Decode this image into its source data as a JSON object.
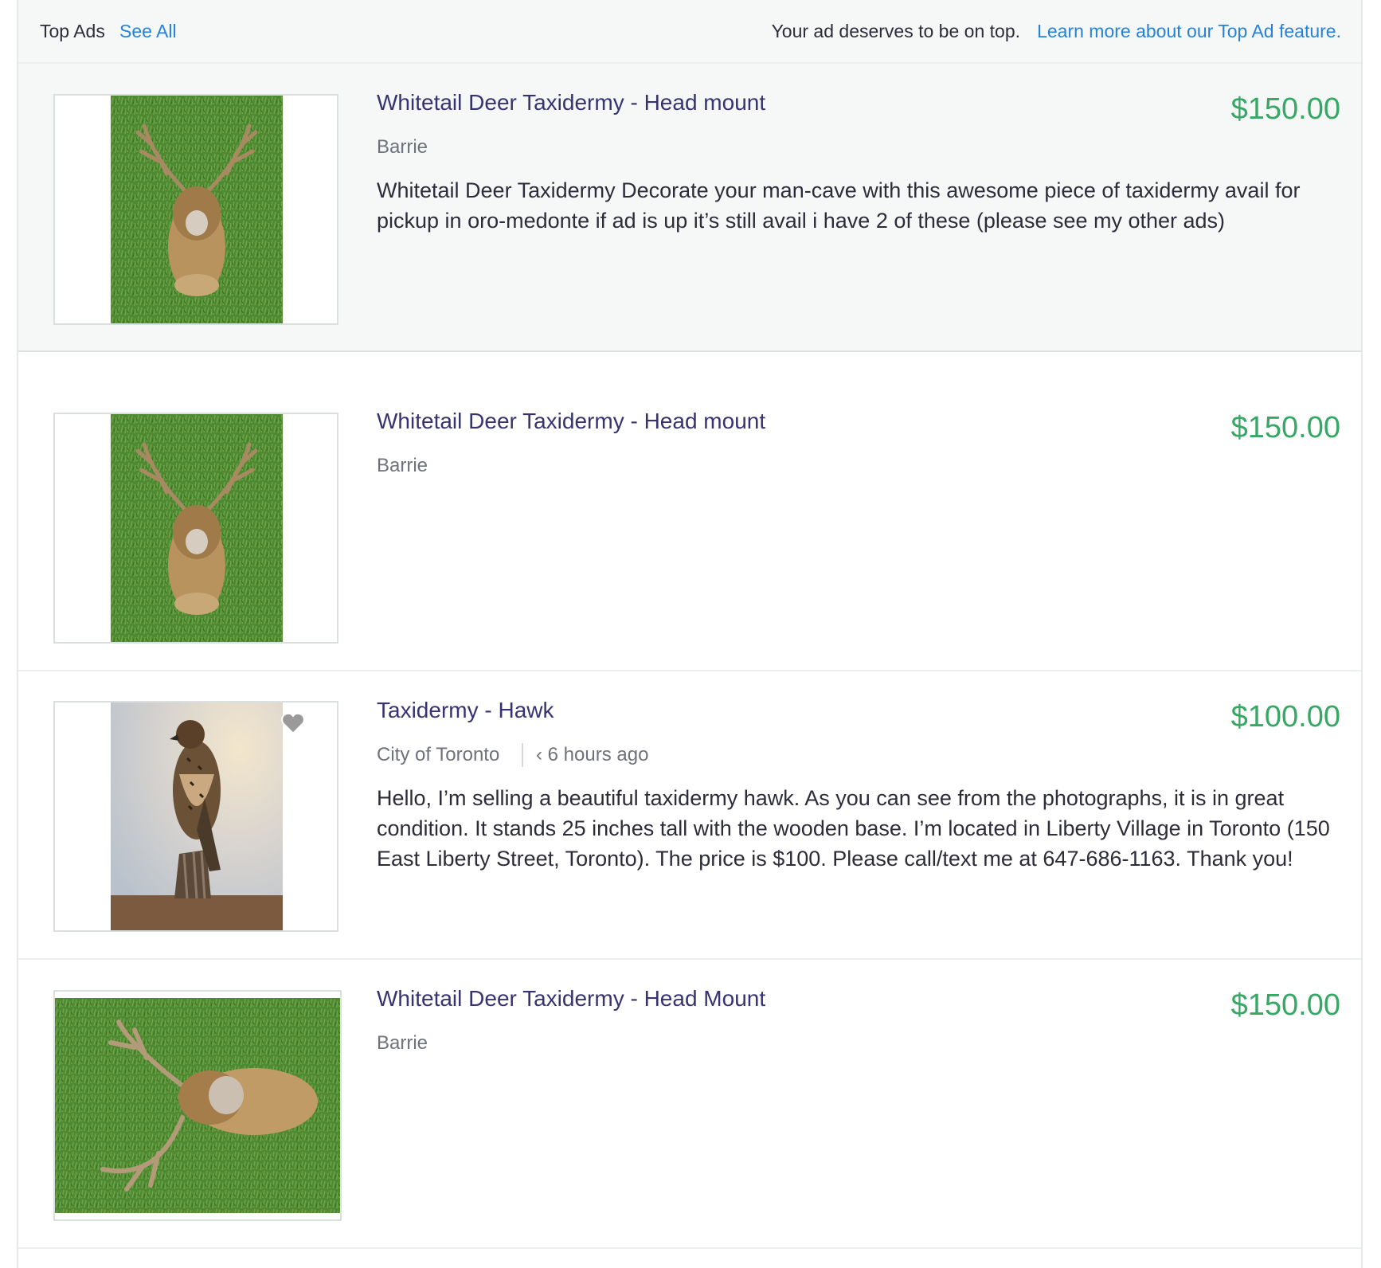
{
  "top_ads_header": {
    "label": "Top Ads",
    "see_all": "See All",
    "promo_text": "Your ad deserves to be on top.",
    "learn_more": "Learn more about our Top Ad feature."
  },
  "listings": [
    {
      "title": "Whitetail Deer Taxidermy - Head mount",
      "price": "$150.00",
      "location": "Barrie",
      "description": "Whitetail Deer Taxidermy Decorate your man-cave with this awesome piece of taxidermy avail for pickup in oro-medonte if ad is up it’s still avail i have 2 of these (please see my other ads)",
      "is_top_ad": true,
      "image": "deer-head-mount-photo"
    },
    {
      "title": "Whitetail Deer Taxidermy - Head mount",
      "price": "$150.00",
      "location": "Barrie",
      "is_top_ad": false,
      "image": "deer-head-mount-photo"
    },
    {
      "title": "Taxidermy - Hawk",
      "price": "$100.00",
      "location": "City of Toronto",
      "posted": "‹ 6 hours ago",
      "description": "Hello, I’m selling a beautiful taxidermy hawk. As you can see from the photographs, it is in great condition. It stands 25 inches tall with the wooden base. I’m located in Liberty Village in Toronto (150 East Liberty Street, Toronto). The price is $100. Please call/text me at 647-686-1163. Thank you!",
      "is_top_ad": false,
      "image": "hawk-taxidermy-photo",
      "favorite_icon": "heart-icon"
    },
    {
      "title": "Whitetail Deer Taxidermy - Head Mount",
      "price": "$150.00",
      "location": "Barrie",
      "is_top_ad": false,
      "image": "deer-head-mount-side-photo"
    }
  ],
  "colors": {
    "title": "#373373",
    "price": "#37a864",
    "link": "#2681db",
    "muted_text": "#6f727d",
    "top_ad_background": "#f6f8f8"
  }
}
